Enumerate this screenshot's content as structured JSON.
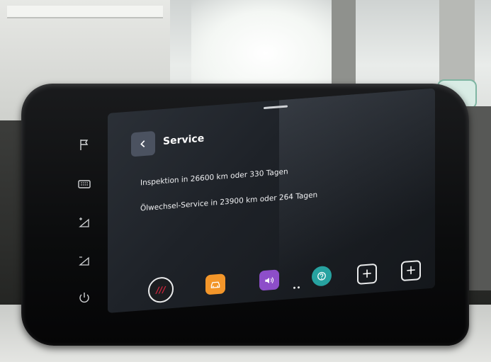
{
  "header": {
    "title": "Service"
  },
  "service": {
    "inspection_text": "Inspektion in 26600 km oder 330 Tagen",
    "oil_text": "Ölwechsel-Service in 23900 km oder 264 Tagen"
  },
  "side_buttons": [
    {
      "icon": "flag-icon"
    },
    {
      "icon": "keyboard-icon"
    },
    {
      "icon": "brightness-up-icon"
    },
    {
      "icon": "brightness-down-icon"
    },
    {
      "icon": "power-icon"
    }
  ],
  "dock": {
    "seat_label": "///",
    "add_label": "+"
  },
  "colors": {
    "car_app": "#f3962a",
    "sound_app": "#8d4ec9",
    "help_app": "#27a2a0",
    "seat_logo": "#d7263d"
  }
}
